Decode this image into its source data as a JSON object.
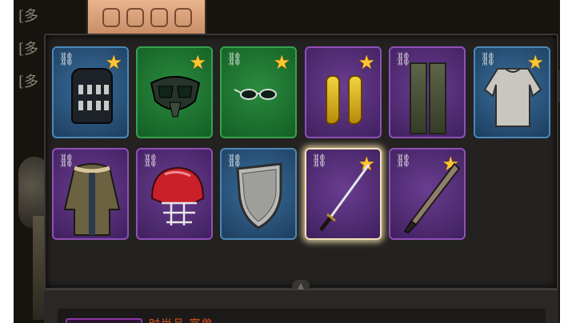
{
  "background": {
    "left_labels": [
      "[多",
      "[多",
      "[多"
    ],
    "bottom_label": "时尚品 富兽",
    "divider_icon": "chevron-up-icon",
    "check_icon": "checkmark-icon"
  },
  "colors": {
    "rarity_blue": "#2b5a85",
    "rarity_green": "#1f7a33",
    "rarity_purple": "#5b2f80",
    "star": "#ffc531",
    "selected_glow": "#f3e2b8",
    "bottom_text": "#e05521"
  },
  "inventory": {
    "rows": [
      [
        {
          "icon": "tactical-vest-icon",
          "rarity": "blue",
          "locked": true,
          "starred": true
        },
        {
          "icon": "gas-mask-icon",
          "rarity": "green",
          "locked": false,
          "starred": true
        },
        {
          "icon": "sunglasses-icon",
          "rarity": "green",
          "locked": true,
          "starred": true
        },
        {
          "icon": "yellow-boots-icon",
          "rarity": "purple",
          "locked": false,
          "starred": true
        },
        {
          "icon": "cargo-pants-icon",
          "rarity": "purple",
          "locked": true,
          "starred": false
        },
        {
          "icon": "shirt-icon",
          "rarity": "blue",
          "locked": true,
          "starred": true
        }
      ],
      [
        {
          "icon": "parka-jacket-icon",
          "rarity": "purple",
          "locked": true,
          "starred": false
        },
        {
          "icon": "football-helmet-icon",
          "rarity": "purple",
          "locked": true,
          "starred": false
        },
        {
          "icon": "metal-shield-icon",
          "rarity": "blue",
          "locked": true,
          "starred": false
        },
        {
          "icon": "katana-icon",
          "rarity": "purple",
          "locked": true,
          "starred": true,
          "selected": true
        },
        {
          "icon": "baseball-bat-icon",
          "rarity": "purple",
          "locked": true,
          "starred": true
        }
      ]
    ]
  }
}
